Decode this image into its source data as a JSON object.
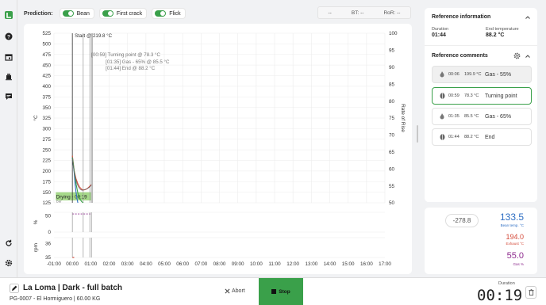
{
  "prediction": {
    "label": "Prediction:",
    "toggles": [
      {
        "label": "Bean",
        "on": true
      },
      {
        "label": "First crack",
        "on": true
      },
      {
        "label": "Flick",
        "on": true
      }
    ]
  },
  "readouts": {
    "et": "--",
    "bt_label": "BT:",
    "bt": "--",
    "ror_label": "RoR:",
    "ror": "--"
  },
  "chart_data": {
    "type": "line",
    "xlabel": "",
    "ylabel": "°C",
    "y2label": "Rate of Rise",
    "xlim": [
      -100,
      1700
    ],
    "ylim": [
      125,
      525
    ],
    "y2lim": [
      50,
      100
    ],
    "x_ticks": [
      "-01:00",
      "00:00",
      "01:00",
      "02:00",
      "03:00",
      "04:00",
      "05:00",
      "06:00",
      "07:00",
      "08:00",
      "09:00",
      "10:00",
      "11:00",
      "12:00",
      "13:00",
      "14:00",
      "15:00",
      "16:00",
      "17:00"
    ],
    "y_ticks": [
      125,
      150,
      175,
      200,
      225,
      250,
      275,
      300,
      325,
      350,
      375,
      400,
      425,
      450,
      475,
      500,
      525
    ],
    "y2_ticks": [
      50,
      55,
      60,
      65,
      70,
      75,
      80,
      85,
      90,
      95,
      100
    ],
    "grid": true,
    "series": [
      {
        "x": [
          0,
          5,
          10,
          20,
          30,
          40,
          50,
          59,
          70,
          80,
          90,
          104
        ],
        "y": [
          236,
          220,
          200,
          182,
          170,
          162,
          157,
          155,
          156,
          158,
          162,
          168
        ]
      },
      {
        "x": [
          0,
          5,
          10,
          15,
          20,
          25,
          30
        ],
        "y": [
          232,
          215,
          195,
          170,
          150,
          135,
          125
        ]
      },
      {
        "x": [
          0,
          10,
          20,
          30,
          40,
          50,
          59
        ],
        "y": [
          232,
          200,
          170,
          148,
          135,
          128,
          125
        ]
      }
    ],
    "events": [
      {
        "t": 0,
        "label": "Start @ 219.8 °C"
      },
      {
        "t": 59,
        "label": "[00:59] Turning point @ 78.3 °C"
      },
      {
        "t": 95,
        "label": "[01:35] Gas - 65% @ 85.5 °C"
      },
      {
        "t": 104,
        "label": "[01:44] End @ 88.2 °C"
      }
    ],
    "phase": {
      "label": "Drying - 00:19",
      "sub": "Bar"
    },
    "gas_panel": {
      "ylabel": "%",
      "ticks": [
        50,
        0
      ],
      "ylim": [
        0,
        60
      ],
      "value": 55
    },
    "drum_panel": {
      "ylabel": "rpm",
      "ticks": [
        36,
        35
      ],
      "ylim": [
        35,
        36.4
      ]
    }
  },
  "reference": {
    "title": "Reference information",
    "duration_label": "Duration",
    "duration": "01:44",
    "end_temp_label": "End temperature",
    "end_temp": "88.2 °C"
  },
  "comments": {
    "title": "Reference comments",
    "items": [
      {
        "time": "00:06",
        "temp": "199.9 °C",
        "text": "Gas - 55%",
        "icon": "flame-icon",
        "state": "selected"
      },
      {
        "time": "00:59",
        "temp": "78.3 °C",
        "text": "Turning point",
        "icon": "bean-icon",
        "state": "active"
      },
      {
        "time": "01:35",
        "temp": "85.5 °C",
        "text": "Gas - 65%",
        "icon": "flame-icon",
        "state": ""
      },
      {
        "time": "01:44",
        "temp": "88.2 °C",
        "text": "End",
        "icon": "bean-icon",
        "state": ""
      }
    ]
  },
  "temps": {
    "target": "-278.8",
    "bean": "133.5",
    "bean_label": "Bean temp. °C",
    "exhaust": "194.0",
    "exhaust_label": "Exhaust °C",
    "gas": "55.0",
    "gas_label": "Gas %"
  },
  "roast": {
    "title": "La Loma | Dark - full batch",
    "subtitle": "PG-0007 - El Hormiguero | 60.00 KG",
    "abort_label": "Abort",
    "stop_label": "Stop",
    "duration_label": "Duration",
    "duration": "00:19"
  },
  "colors": {
    "accent": "#3aa04a",
    "bean": "#2f6fc4",
    "exhaust": "#d44a3a",
    "gas": "#8e2c8e",
    "phase": "#a6d98a"
  }
}
